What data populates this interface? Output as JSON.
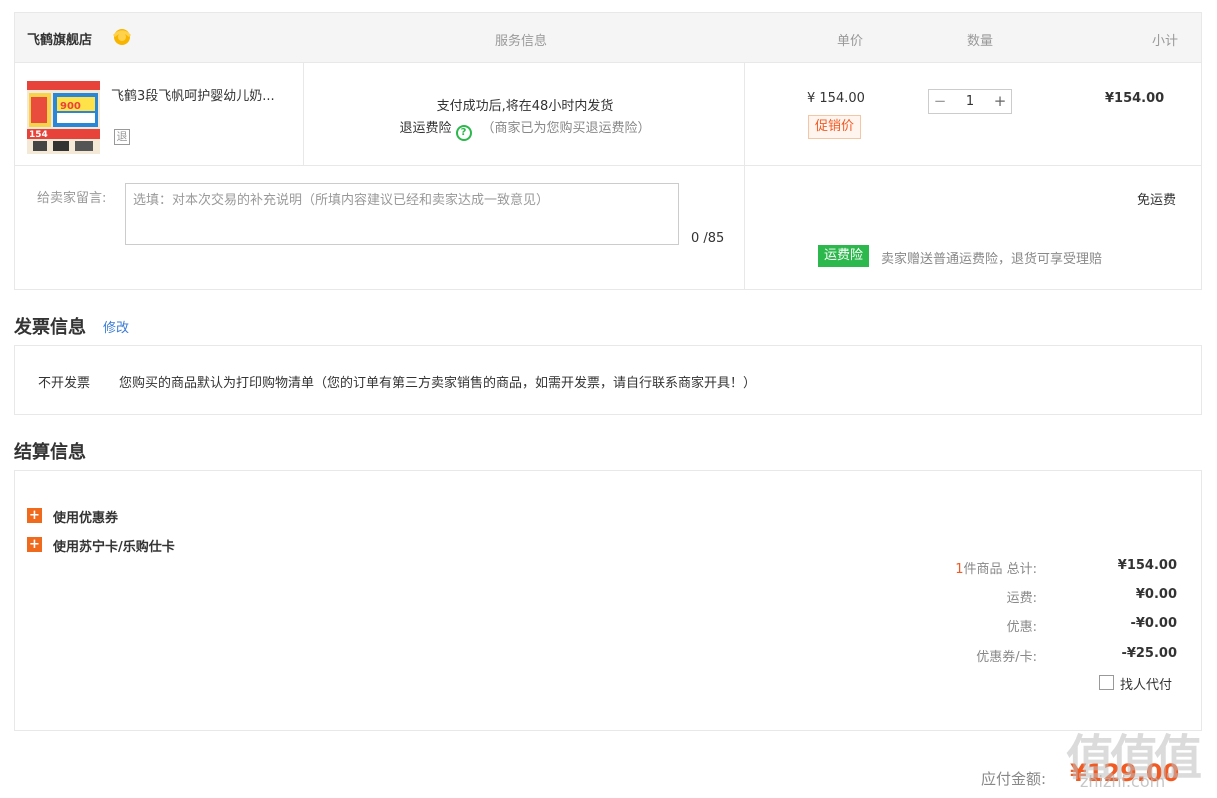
{
  "order": {
    "store_name": "飞鹤旗舰店",
    "columns": {
      "service": "服务信息",
      "unit_price": "单价",
      "quantity": "数量",
      "subtotal": "小计"
    },
    "product": {
      "title": "飞鹤3段飞帆呵护婴幼儿奶...",
      "return_badge": "退",
      "thumb_price": "154",
      "thumb_badge": "900",
      "ship_text": "支付成功后,将在48小时内发货",
      "insurance_label": "退运费险",
      "insurance_note": "（商家已为您购买退运费险）",
      "unit_price": "¥ 154.00",
      "promo_badge": "促销价",
      "quantity": "1",
      "qty_minus": "−",
      "qty_plus": "+",
      "subtotal": "¥154.00"
    },
    "message": {
      "label": "给卖家留言:",
      "placeholder": "选填：对本次交易的补充说明（所填内容建议已经和卖家达成一致意见）",
      "count": "0 /85"
    },
    "shipping": {
      "free_text": "免运费",
      "insurance_badge": "运费险",
      "insurance_desc": "卖家赠送普通运费险，退货可享受理赔"
    }
  },
  "invoice": {
    "title": "发票信息",
    "edit_label": "修改",
    "type": "不开发票",
    "description": "您购买的商品默认为打印购物清单（您的订单有第三方卖家销售的商品，如需开发票，请自行联系商家开具！）"
  },
  "settlement": {
    "title": "结算信息",
    "options": [
      "使用优惠券",
      "使用苏宁卡/乐购仕卡"
    ],
    "item_count": "1",
    "total_label": "件商品 总计:",
    "total_value": "¥154.00",
    "shipping_label": "运费:",
    "shipping_value": "¥0.00",
    "discount_label": "优惠:",
    "discount_value": "-¥0.00",
    "coupon_label": "优惠券/卡:",
    "coupon_value": "-¥25.00",
    "proxy_pay_label": "找人代付",
    "due_label": "应付金额:",
    "due_amount": "¥129.00"
  },
  "watermark": {
    "glyphs": "值值值",
    "text": "zhizhi.com"
  },
  "colors": {
    "accent": "#f15a22",
    "green": "#2db84d",
    "link": "#3a7bd5",
    "border": "#e8e8e8"
  }
}
